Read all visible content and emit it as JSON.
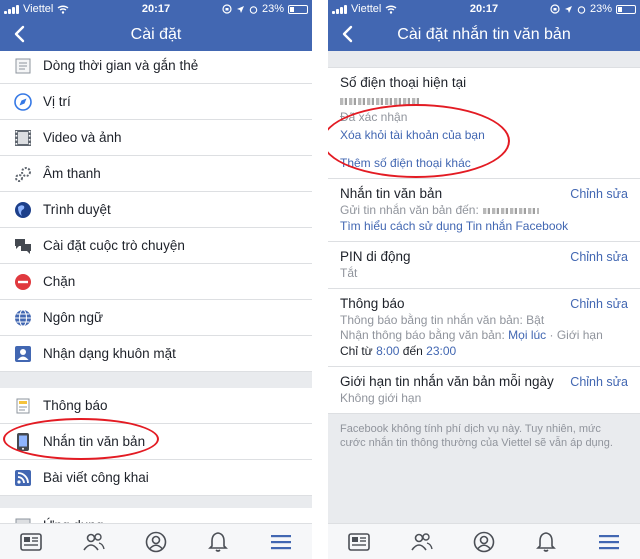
{
  "left": {
    "status": {
      "carrier": "Viettel",
      "time": "20:17",
      "battery": "23%"
    },
    "nav": {
      "title": "Cài đặt"
    },
    "group1": [
      {
        "id": "timeline",
        "label": "Dòng thời gian và gắn thẻ",
        "icon": "timeline-icon"
      },
      {
        "id": "location",
        "label": "Vị trí",
        "icon": "location-icon"
      },
      {
        "id": "video",
        "label": "Video và ảnh",
        "icon": "film-icon"
      },
      {
        "id": "sound",
        "label": "Âm thanh",
        "icon": "sound-icon"
      },
      {
        "id": "browser",
        "label": "Trình duyệt",
        "icon": "globe-icon"
      },
      {
        "id": "chat",
        "label": "Cài đặt cuộc trò chuyện",
        "icon": "chat-icon"
      },
      {
        "id": "block",
        "label": "Chặn",
        "icon": "block-icon"
      },
      {
        "id": "language",
        "label": "Ngôn ngữ",
        "icon": "language-globe-icon"
      },
      {
        "id": "face",
        "label": "Nhận dạng khuôn mặt",
        "icon": "face-id-icon"
      }
    ],
    "group2": [
      {
        "id": "notifications",
        "label": "Thông báo",
        "icon": "notification-icon"
      },
      {
        "id": "sms",
        "label": "Nhắn tin văn bản",
        "icon": "phone-icon"
      },
      {
        "id": "public-posts",
        "label": "Bài viết công khai",
        "icon": "rss-icon"
      },
      {
        "id": "apps",
        "label": "Ứng dụng",
        "icon": "apps-icon"
      }
    ]
  },
  "right": {
    "status": {
      "carrier": "Viettel",
      "time": "20:17",
      "battery": "23%"
    },
    "nav": {
      "title": "Cài đặt nhắn tin văn bản"
    },
    "phone": {
      "title": "Số điện thoại hiện tại",
      "verified": "Đã xác nhận",
      "remove": "Xóa khỏi tài khoản của bạn",
      "add": "Thêm số điện thoại khác"
    },
    "sms": {
      "title": "Nhắn tin văn bản",
      "edit": "Chỉnh sửa",
      "send_to": "Gửi tin nhắn văn bản đến:",
      "learn": "Tìm hiểu cách sử dụng Tin nhắn Facebook"
    },
    "pin": {
      "title": "PIN di động",
      "edit": "Chỉnh sửa",
      "value": "Tắt"
    },
    "notify": {
      "title": "Thông báo",
      "edit": "Chỉnh sửa",
      "line1": "Thông báo bằng tin nhắn văn bản: Bật",
      "line2_prefix": "Nhận thông báo bằng văn bản:",
      "line2_link": "Mọi lúc",
      "line2_suffix": "· Giới hạn",
      "line3_prefix": "Chỉ từ",
      "from": "8:00",
      "mid": "đến",
      "to": "23:00"
    },
    "limit": {
      "title": "Giới hạn tin nhắn văn bản mỗi ngày",
      "edit": "Chỉnh sửa",
      "value": "Không giới hạn"
    },
    "note": "Facebook không tính phí dịch vụ này. Tuy nhiên, mức cước nhắn tin thông thường của Viettel sẽ vẫn áp dụng."
  },
  "tabbar_icons": [
    "news-feed-icon",
    "friends-icon",
    "profile-icon",
    "bell-icon",
    "menu-icon"
  ],
  "colors": {
    "brand": "#4267b2",
    "highlight": "#e31b23",
    "background": "#e9ebee"
  }
}
